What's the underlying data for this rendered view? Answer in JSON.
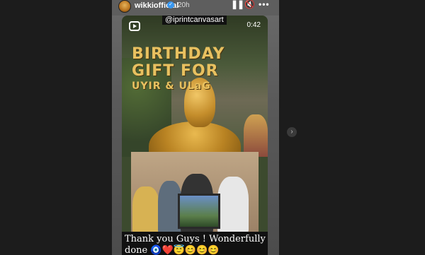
{
  "header": {
    "username": "wikkiofficial",
    "time": "20h",
    "icons": {
      "pause": "pause-icon",
      "mute": "mute-icon",
      "more": "more-options-icon"
    }
  },
  "reel": {
    "tag": "@iprintcanvasart",
    "duration": "0:42",
    "title": {
      "line1": "BIRTHDAY",
      "line2": "GIFT FOR",
      "line3": "UYIR & ULaG"
    },
    "caption": "Thank you Guys ! Wonderfully done 🧿❤️😇😊😊😊"
  },
  "nav": {
    "next_icon": "chevron-right-icon"
  },
  "colors": {
    "accent_gold": "#e8c160",
    "background": "#1a1a1a",
    "verified_blue": "#3897f0"
  }
}
